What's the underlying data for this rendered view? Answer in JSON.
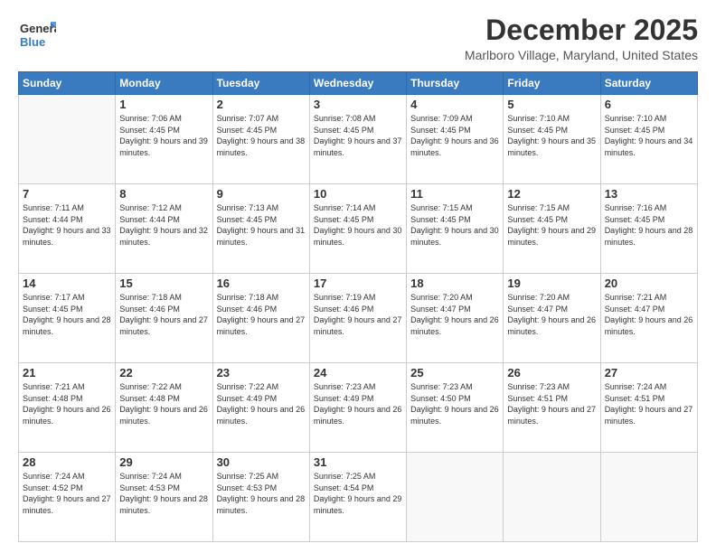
{
  "logo": {
    "general": "General",
    "blue": "Blue"
  },
  "title": "December 2025",
  "location": "Marlboro Village, Maryland, United States",
  "days_of_week": [
    "Sunday",
    "Monday",
    "Tuesday",
    "Wednesday",
    "Thursday",
    "Friday",
    "Saturday"
  ],
  "weeks": [
    [
      {
        "day": "",
        "sunrise": "",
        "sunset": "",
        "daylight": ""
      },
      {
        "day": "1",
        "sunrise": "Sunrise: 7:06 AM",
        "sunset": "Sunset: 4:45 PM",
        "daylight": "Daylight: 9 hours and 39 minutes."
      },
      {
        "day": "2",
        "sunrise": "Sunrise: 7:07 AM",
        "sunset": "Sunset: 4:45 PM",
        "daylight": "Daylight: 9 hours and 38 minutes."
      },
      {
        "day": "3",
        "sunrise": "Sunrise: 7:08 AM",
        "sunset": "Sunset: 4:45 PM",
        "daylight": "Daylight: 9 hours and 37 minutes."
      },
      {
        "day": "4",
        "sunrise": "Sunrise: 7:09 AM",
        "sunset": "Sunset: 4:45 PM",
        "daylight": "Daylight: 9 hours and 36 minutes."
      },
      {
        "day": "5",
        "sunrise": "Sunrise: 7:10 AM",
        "sunset": "Sunset: 4:45 PM",
        "daylight": "Daylight: 9 hours and 35 minutes."
      },
      {
        "day": "6",
        "sunrise": "Sunrise: 7:10 AM",
        "sunset": "Sunset: 4:45 PM",
        "daylight": "Daylight: 9 hours and 34 minutes."
      }
    ],
    [
      {
        "day": "7",
        "sunrise": "Sunrise: 7:11 AM",
        "sunset": "Sunset: 4:44 PM",
        "daylight": "Daylight: 9 hours and 33 minutes."
      },
      {
        "day": "8",
        "sunrise": "Sunrise: 7:12 AM",
        "sunset": "Sunset: 4:44 PM",
        "daylight": "Daylight: 9 hours and 32 minutes."
      },
      {
        "day": "9",
        "sunrise": "Sunrise: 7:13 AM",
        "sunset": "Sunset: 4:45 PM",
        "daylight": "Daylight: 9 hours and 31 minutes."
      },
      {
        "day": "10",
        "sunrise": "Sunrise: 7:14 AM",
        "sunset": "Sunset: 4:45 PM",
        "daylight": "Daylight: 9 hours and 30 minutes."
      },
      {
        "day": "11",
        "sunrise": "Sunrise: 7:15 AM",
        "sunset": "Sunset: 4:45 PM",
        "daylight": "Daylight: 9 hours and 30 minutes."
      },
      {
        "day": "12",
        "sunrise": "Sunrise: 7:15 AM",
        "sunset": "Sunset: 4:45 PM",
        "daylight": "Daylight: 9 hours and 29 minutes."
      },
      {
        "day": "13",
        "sunrise": "Sunrise: 7:16 AM",
        "sunset": "Sunset: 4:45 PM",
        "daylight": "Daylight: 9 hours and 28 minutes."
      }
    ],
    [
      {
        "day": "14",
        "sunrise": "Sunrise: 7:17 AM",
        "sunset": "Sunset: 4:45 PM",
        "daylight": "Daylight: 9 hours and 28 minutes."
      },
      {
        "day": "15",
        "sunrise": "Sunrise: 7:18 AM",
        "sunset": "Sunset: 4:46 PM",
        "daylight": "Daylight: 9 hours and 27 minutes."
      },
      {
        "day": "16",
        "sunrise": "Sunrise: 7:18 AM",
        "sunset": "Sunset: 4:46 PM",
        "daylight": "Daylight: 9 hours and 27 minutes."
      },
      {
        "day": "17",
        "sunrise": "Sunrise: 7:19 AM",
        "sunset": "Sunset: 4:46 PM",
        "daylight": "Daylight: 9 hours and 27 minutes."
      },
      {
        "day": "18",
        "sunrise": "Sunrise: 7:20 AM",
        "sunset": "Sunset: 4:47 PM",
        "daylight": "Daylight: 9 hours and 26 minutes."
      },
      {
        "day": "19",
        "sunrise": "Sunrise: 7:20 AM",
        "sunset": "Sunset: 4:47 PM",
        "daylight": "Daylight: 9 hours and 26 minutes."
      },
      {
        "day": "20",
        "sunrise": "Sunrise: 7:21 AM",
        "sunset": "Sunset: 4:47 PM",
        "daylight": "Daylight: 9 hours and 26 minutes."
      }
    ],
    [
      {
        "day": "21",
        "sunrise": "Sunrise: 7:21 AM",
        "sunset": "Sunset: 4:48 PM",
        "daylight": "Daylight: 9 hours and 26 minutes."
      },
      {
        "day": "22",
        "sunrise": "Sunrise: 7:22 AM",
        "sunset": "Sunset: 4:48 PM",
        "daylight": "Daylight: 9 hours and 26 minutes."
      },
      {
        "day": "23",
        "sunrise": "Sunrise: 7:22 AM",
        "sunset": "Sunset: 4:49 PM",
        "daylight": "Daylight: 9 hours and 26 minutes."
      },
      {
        "day": "24",
        "sunrise": "Sunrise: 7:23 AM",
        "sunset": "Sunset: 4:49 PM",
        "daylight": "Daylight: 9 hours and 26 minutes."
      },
      {
        "day": "25",
        "sunrise": "Sunrise: 7:23 AM",
        "sunset": "Sunset: 4:50 PM",
        "daylight": "Daylight: 9 hours and 26 minutes."
      },
      {
        "day": "26",
        "sunrise": "Sunrise: 7:23 AM",
        "sunset": "Sunset: 4:51 PM",
        "daylight": "Daylight: 9 hours and 27 minutes."
      },
      {
        "day": "27",
        "sunrise": "Sunrise: 7:24 AM",
        "sunset": "Sunset: 4:51 PM",
        "daylight": "Daylight: 9 hours and 27 minutes."
      }
    ],
    [
      {
        "day": "28",
        "sunrise": "Sunrise: 7:24 AM",
        "sunset": "Sunset: 4:52 PM",
        "daylight": "Daylight: 9 hours and 27 minutes."
      },
      {
        "day": "29",
        "sunrise": "Sunrise: 7:24 AM",
        "sunset": "Sunset: 4:53 PM",
        "daylight": "Daylight: 9 hours and 28 minutes."
      },
      {
        "day": "30",
        "sunrise": "Sunrise: 7:25 AM",
        "sunset": "Sunset: 4:53 PM",
        "daylight": "Daylight: 9 hours and 28 minutes."
      },
      {
        "day": "31",
        "sunrise": "Sunrise: 7:25 AM",
        "sunset": "Sunset: 4:54 PM",
        "daylight": "Daylight: 9 hours and 29 minutes."
      },
      {
        "day": "",
        "sunrise": "",
        "sunset": "",
        "daylight": ""
      },
      {
        "day": "",
        "sunrise": "",
        "sunset": "",
        "daylight": ""
      },
      {
        "day": "",
        "sunrise": "",
        "sunset": "",
        "daylight": ""
      }
    ]
  ]
}
